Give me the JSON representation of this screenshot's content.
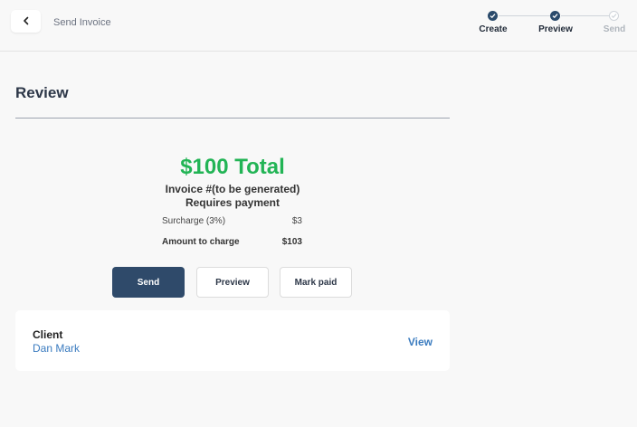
{
  "header": {
    "page_label": "Send Invoice",
    "back_icon": "chevron-left-icon"
  },
  "stepper": {
    "steps": [
      {
        "label": "Create",
        "status": "done"
      },
      {
        "label": "Preview",
        "status": "done"
      },
      {
        "label": "Send",
        "status": "pending"
      }
    ]
  },
  "review": {
    "title": "Review",
    "total": "$100 Total",
    "invoice_number": "Invoice #(to be generated)",
    "payment_status": "Requires payment",
    "surcharge_label": "Surcharge (3%)",
    "surcharge_value": "$3",
    "amount_label": "Amount to charge",
    "amount_value": "$103"
  },
  "actions": {
    "send_label": "Send",
    "preview_label": "Preview",
    "mark_paid_label": "Mark paid"
  },
  "client": {
    "title": "Client",
    "name": "Dan Mark",
    "view_label": "View"
  },
  "colors": {
    "accent_green": "#22b455",
    "primary_navy": "#2f4a6a",
    "link_blue": "#3a7bbf"
  }
}
